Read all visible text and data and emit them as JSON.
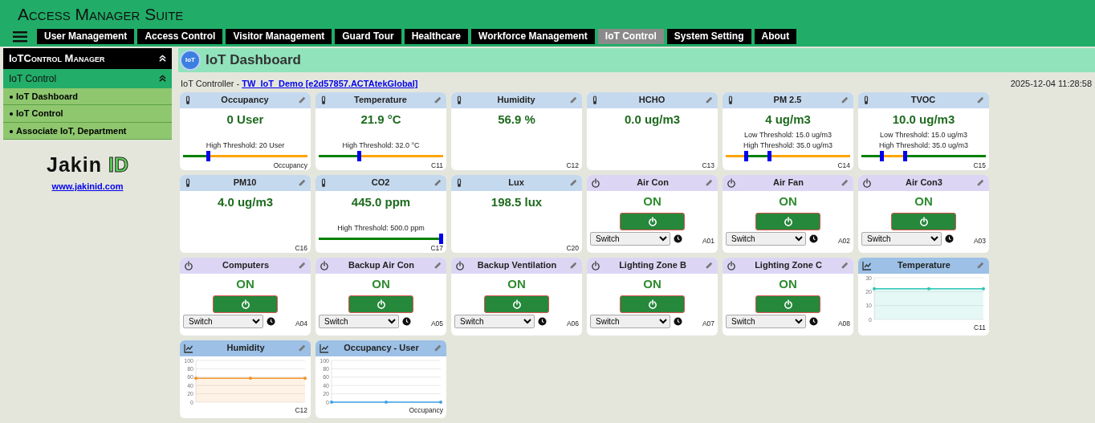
{
  "app": {
    "title": "Access Manager Suite"
  },
  "nav": [
    {
      "label": "User Management",
      "selected": false
    },
    {
      "label": "Access Control",
      "selected": false
    },
    {
      "label": "Visitor Management",
      "selected": false
    },
    {
      "label": "Guard Tour",
      "selected": false
    },
    {
      "label": "Healthcare",
      "selected": false
    },
    {
      "label": "Workforce Management",
      "selected": false
    },
    {
      "label": "IoT Control",
      "selected": true
    },
    {
      "label": "System Setting",
      "selected": false
    },
    {
      "label": "About",
      "selected": false
    }
  ],
  "sidebar": {
    "title": "IoTControl Manager",
    "section": {
      "label": "IoT Control",
      "expanded": true,
      "items": [
        {
          "label": "IoT Dashboard"
        },
        {
          "label": "IoT Control"
        },
        {
          "label": "Associate IoT, Department"
        }
      ]
    },
    "logo": {
      "word": "Jakin",
      "mark": "ID"
    },
    "link": "www.jakinid.com"
  },
  "page": {
    "icon_label": "IoT",
    "title": "IoT Dashboard",
    "controller_label": "IoT Controller - ",
    "controller": "TW_IoT_Demo [e2d57857.ACTAtekGlobal]",
    "datetime": "2025-12-04 11:28:58"
  },
  "cards": [
    {
      "kind": "sensor",
      "title": "Occupancy",
      "value": "0 User",
      "thresholds": [
        "High Threshold: 20 User"
      ],
      "slider": {
        "segments": [
          {
            "color": "#008000"
          },
          {
            "color": "#ffa500"
          }
        ],
        "thumbs": [
          {
            "level": 0.2
          }
        ]
      },
      "code": "Occupancy"
    },
    {
      "kind": "sensor",
      "title": "Temperature",
      "value": "21.9 °C",
      "thresholds": [
        "High Threshold: 32.0 °C"
      ],
      "slider": {
        "segments": [
          {
            "color": "#008000"
          },
          {
            "color": "#ffa500"
          }
        ],
        "thumbs": [
          {
            "level": 0.32
          }
        ]
      },
      "code": "C11"
    },
    {
      "kind": "sensor",
      "title": "Humidity",
      "value": "56.9 %",
      "code": "C12"
    },
    {
      "kind": "sensor",
      "title": "HCHO",
      "value": "0.0 ug/m3",
      "code": "C13"
    },
    {
      "kind": "sensor",
      "title": "PM 2.5",
      "value": "4 ug/m3",
      "thresholds": [
        "Low Threshold: 15.0 ug/m3",
        "High Threshold: 35.0 ug/m3"
      ],
      "slider": {
        "segments": [
          {
            "color": "#ffa500"
          },
          {
            "color": "#008000"
          },
          {
            "color": "#ffa500"
          }
        ],
        "thumbs": [
          {
            "level": 0.16
          },
          {
            "level": 0.35
          }
        ]
      },
      "code": "C14"
    },
    {
      "kind": "sensor",
      "title": "TVOC",
      "value": "10.0 ug/m3",
      "thresholds": [
        "Low Threshold: 15.0 ug/m3",
        "High Threshold: 35.0 ug/m3"
      ],
      "slider": {
        "segments": [
          {
            "color": "#008000"
          },
          {
            "color": "#ffa500"
          },
          {
            "color": "#008000"
          }
        ],
        "thumbs": [
          {
            "level": 0.16
          },
          {
            "level": 0.35
          }
        ]
      },
      "code": "C15"
    },
    {
      "kind": "sensor",
      "title": "PM10",
      "value": "4.0 ug/m3",
      "code": "C16"
    },
    {
      "kind": "sensor",
      "title": "CO2",
      "value": "445.0 ppm",
      "thresholds": [
        "High Threshold: 500.0 ppm"
      ],
      "slider": {
        "segments": [
          {
            "color": "#008000"
          }
        ],
        "thumbs": [
          {
            "level": 1.0
          }
        ]
      },
      "code": "C17"
    },
    {
      "kind": "sensor",
      "title": "Lux",
      "value": "198.5 lux",
      "code": "C20"
    },
    {
      "kind": "switch",
      "title": "Air Con",
      "state": "ON",
      "on": true,
      "mode": "Switch",
      "code": "A01"
    },
    {
      "kind": "switch",
      "title": "Air Fan",
      "state": "ON",
      "on": true,
      "mode": "Switch",
      "code": "A02"
    },
    {
      "kind": "switch",
      "title": "Air Con3",
      "state": "ON",
      "on": true,
      "mode": "Switch",
      "code": "A03"
    },
    {
      "kind": "switch",
      "title": "Computers",
      "state": "ON",
      "on": true,
      "mode": "Switch",
      "code": "A04"
    },
    {
      "kind": "switch",
      "title": "Backup Air Con",
      "state": "ON",
      "on": true,
      "mode": "Switch",
      "code": "A05"
    },
    {
      "kind": "switch",
      "title": "Backup Ventilation",
      "state": "ON",
      "on": true,
      "mode": "Switch",
      "code": "A06"
    },
    {
      "kind": "switch",
      "title": "Lighting Zone B",
      "state": "ON",
      "on": true,
      "mode": "Switch",
      "code": "A07"
    },
    {
      "kind": "switch",
      "title": "Lighting Zone C",
      "state": "ON",
      "on": true,
      "mode": "Switch",
      "code": "A08"
    },
    {
      "kind": "chart",
      "title": "Temperature",
      "code": "C11",
      "chart_data": {
        "type": "area",
        "grid": true,
        "series": [
          {
            "color": "#2ec4b6",
            "values": [
              22,
              22,
              22
            ]
          }
        ],
        "ylim": [
          0,
          30
        ],
        "yticks": [
          0,
          10,
          20,
          30
        ]
      }
    },
    {
      "kind": "chart",
      "title": "Humidity",
      "code": "C12",
      "chart_data": {
        "type": "area",
        "grid": true,
        "series": [
          {
            "color": "#f0932b",
            "values": [
              57,
              57,
              57
            ]
          }
        ],
        "ylim": [
          0,
          100
        ],
        "yticks": [
          0,
          20,
          40,
          60,
          80,
          100
        ]
      }
    },
    {
      "kind": "chart",
      "title": "Occupancy - User",
      "code": "Occupancy",
      "chart_data": {
        "type": "line",
        "grid": true,
        "series": [
          {
            "color": "#3fa0e8",
            "values": [
              0,
              0,
              0
            ]
          }
        ],
        "ylim": [
          0,
          100
        ],
        "yticks": [
          0,
          20,
          40,
          60,
          80,
          100
        ]
      }
    }
  ]
}
